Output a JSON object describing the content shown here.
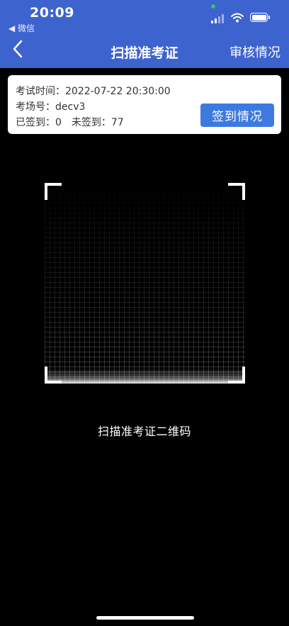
{
  "status_bar": {
    "time": "20:09",
    "back_app": "◀ 微信"
  },
  "nav": {
    "title": "扫描准考证",
    "right_label": "审核情况"
  },
  "exam_info": {
    "time_label": "考试时间：",
    "time_value": "2022-07-22 20:30:00",
    "room_label": "考场号：",
    "room_value": "decv3",
    "signed_label": "已签到：",
    "signed_value": "0",
    "unsigned_label": "未签到：",
    "unsigned_value": "77",
    "button_label": "签到情况"
  },
  "scanner": {
    "hint": "扫描准考证二维码"
  },
  "colors": {
    "accent": "#3d63cf",
    "button": "#3d7ae0",
    "background": "#000000"
  },
  "icons": [
    "back-arrow-icon",
    "signal-icon",
    "wifi-icon",
    "battery-icon"
  ]
}
